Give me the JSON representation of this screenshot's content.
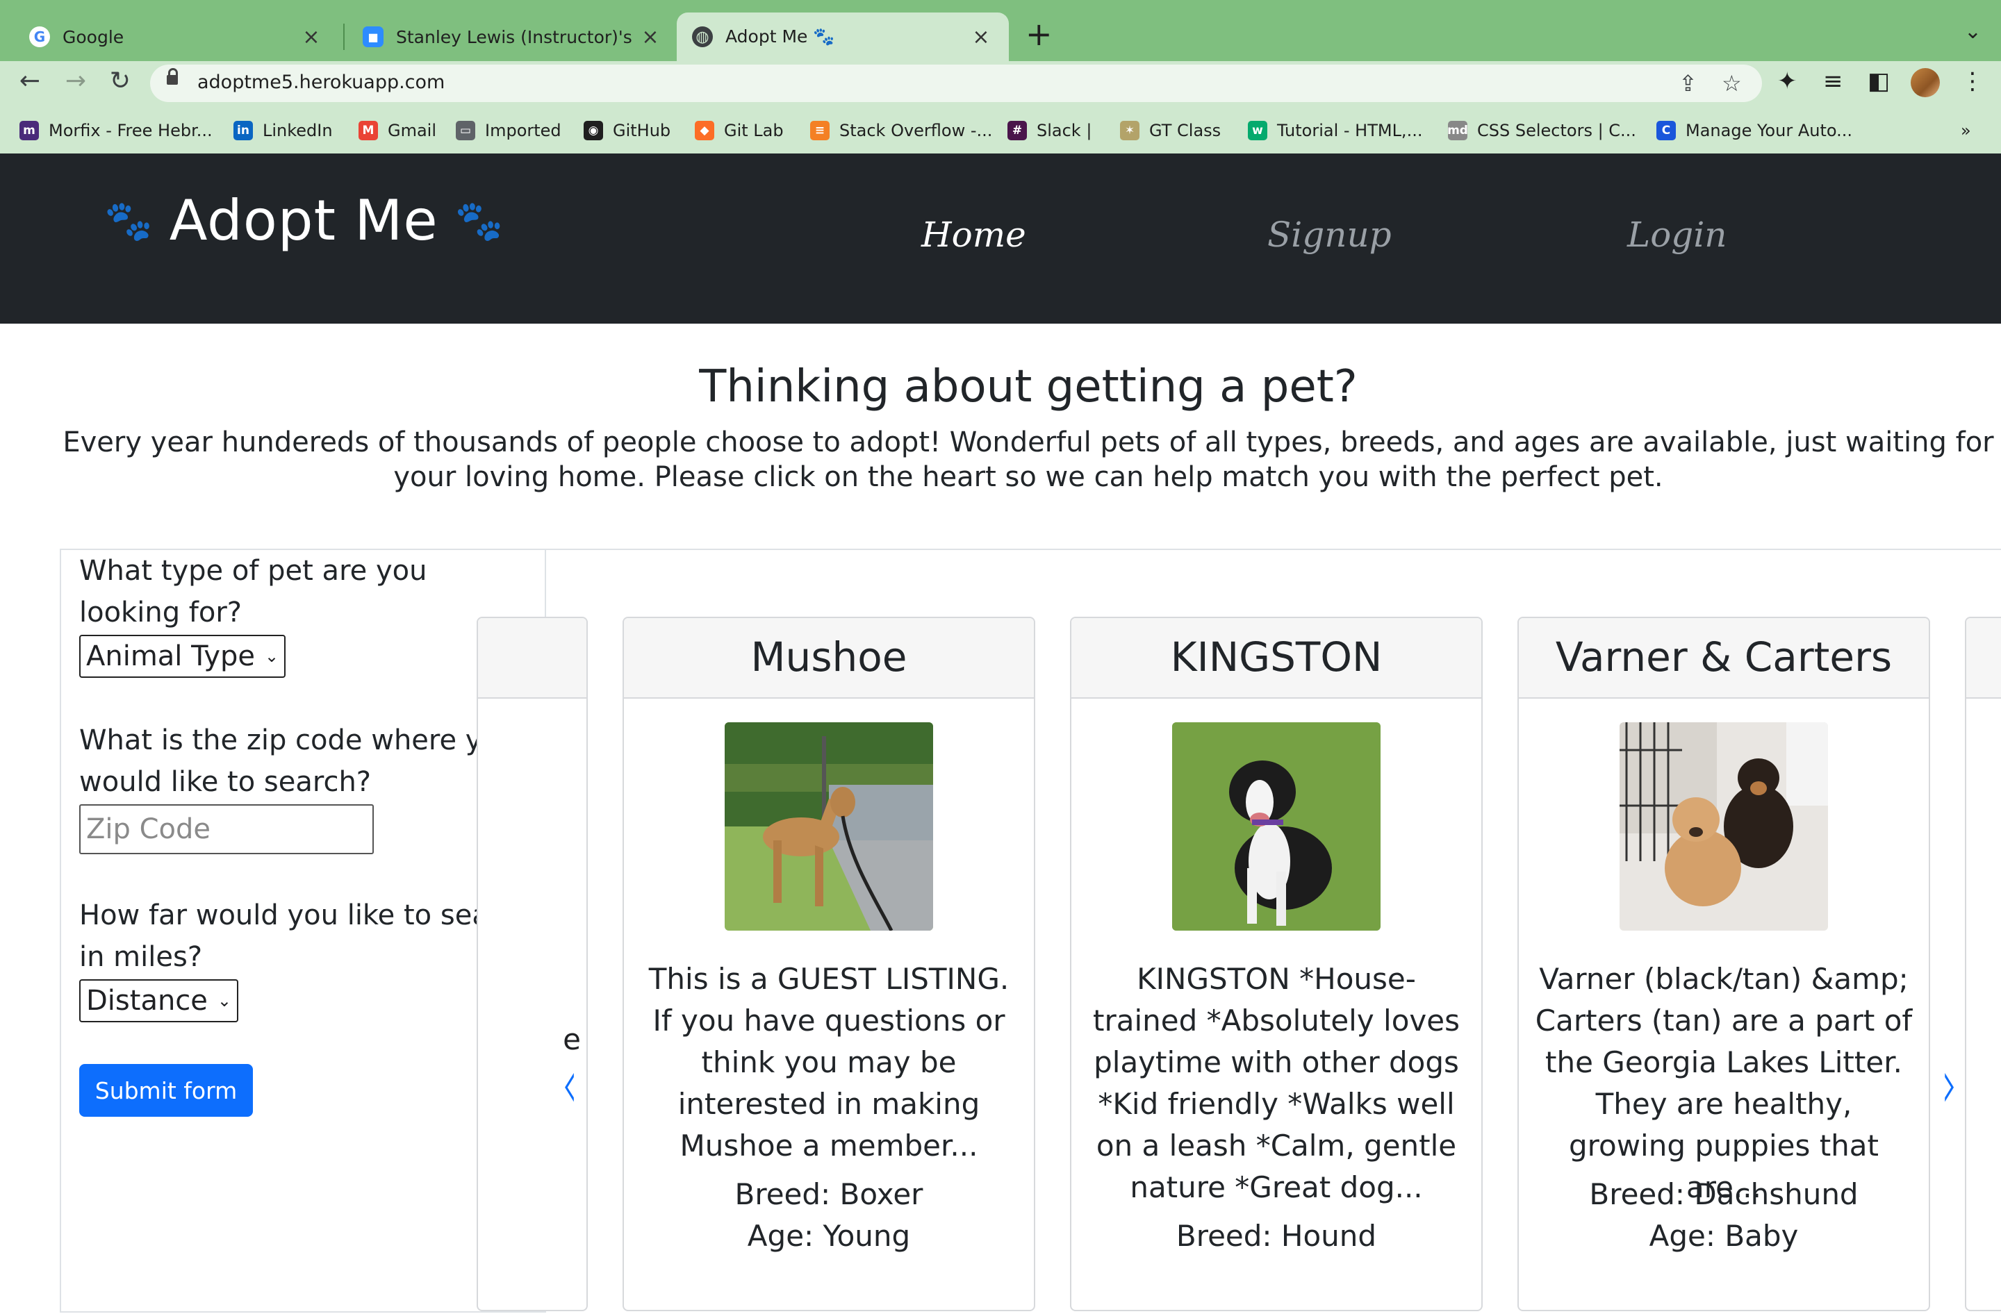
{
  "browser": {
    "tabs": [
      {
        "title": "Google",
        "icon": "google-icon"
      },
      {
        "title": "Stanley Lewis (Instructor)'s Per",
        "icon": "zoom-video-icon"
      },
      {
        "title": "Adopt Me 🐾",
        "icon": "globe-icon",
        "active": true
      }
    ],
    "paw_glyph": "🐾",
    "url": "adoptme5.herokuapp.com",
    "bookmarks": [
      {
        "label": "Morfix - Free Hebr...",
        "icon": "morfix-icon",
        "color": "#4a2a7a"
      },
      {
        "label": "LinkedIn",
        "icon": "linkedin-icon",
        "color": "#0a66c2"
      },
      {
        "label": "Gmail",
        "icon": "gmail-icon",
        "color": "#ea4335"
      },
      {
        "label": "Imported",
        "icon": "folder-icon",
        "color": "#5f6368"
      },
      {
        "label": "GitHub",
        "icon": "github-icon",
        "color": "#1f1f1f"
      },
      {
        "label": "Git Lab",
        "icon": "gitlab-icon",
        "color": "#fc6d26"
      },
      {
        "label": "Stack Overflow -...",
        "icon": "stackoverflow-icon",
        "color": "#f48024"
      },
      {
        "label": "Slack |",
        "icon": "slack-icon",
        "color": "#4a154b"
      },
      {
        "label": "GT Class",
        "icon": "gt-bee-icon",
        "color": "#b3a369"
      },
      {
        "label": "Tutorial - HTML,...",
        "icon": "w3schools-icon",
        "color": "#04aa6d"
      },
      {
        "label": "CSS Selectors | C...",
        "icon": "md-icon",
        "color": "#888888"
      },
      {
        "label": "Manage Your Auto...",
        "icon": "c-icon",
        "color": "#1a56db"
      }
    ],
    "more_bookmarks": "»"
  },
  "nav": {
    "brand": "Adopt Me",
    "links": [
      {
        "label": "Home",
        "active": true
      },
      {
        "label": "Signup",
        "active": false
      },
      {
        "label": "Login",
        "active": false
      }
    ]
  },
  "hero": {
    "title": "Thinking about getting a pet?",
    "text": "Every year hundereds of thousands of people choose to adopt! Wonderful pets of all types, breeds, and ages are available, just waiting for your loving home. Please click on the heart so we can help match you with the perfect pet."
  },
  "form": {
    "q_type": "What type of pet are you looking for?",
    "type_value": "Animal Type",
    "q_zip": "What is the zip code where you would like to search?",
    "zip_placeholder": "Zip Code",
    "q_distance": "How far would you like to search in miles?",
    "distance_value": "Distance",
    "submit": "Submit form"
  },
  "carousel": {
    "partial_left_char": "e",
    "prev": "‹",
    "next": "›",
    "cards": [
      {
        "name": "Mushoe",
        "description": "This is a GUEST LISTING. If you have questions or think you may be interested in making Mushoe a member...",
        "breed": "Breed: Boxer",
        "age": "Age: Young"
      },
      {
        "name": "KINGSTON",
        "description": "KINGSTON *House-trained *Absolutely loves playtime with other dogs *Kid friendly *Walks well on a leash *Calm, gentle nature *Great dog...",
        "breed": "Breed: Hound",
        "age": ""
      },
      {
        "name": "Varner & Carters",
        "description": "Varner (black/tan) &amp; Carters (tan) are a part of the Georgia Lakes Litter. They are healthy, growing puppies that are...",
        "breed": "Breed: Dachshund",
        "age": "Age: Baby"
      }
    ]
  }
}
